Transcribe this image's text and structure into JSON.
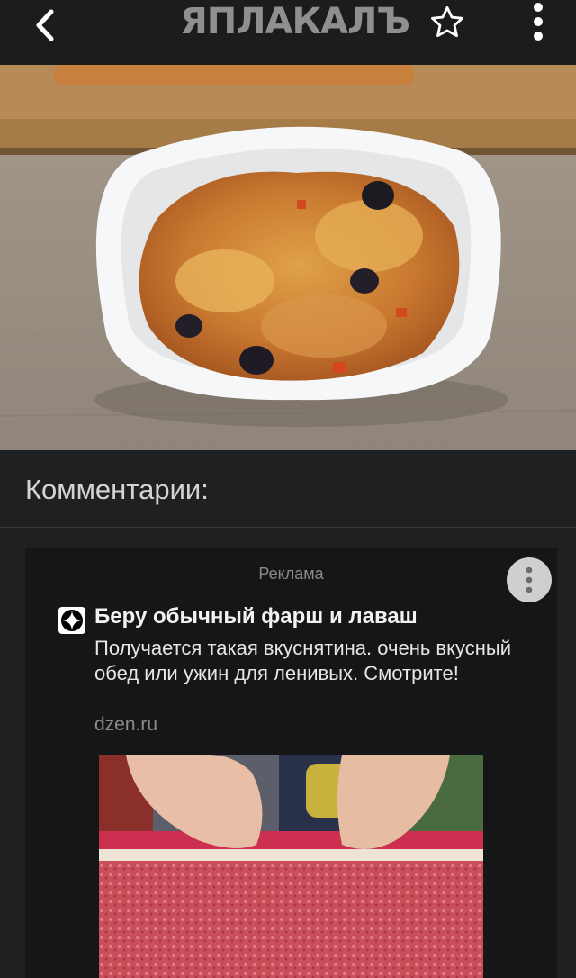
{
  "header": {
    "logo_text": "ЯПЛАКАЛЪ",
    "back_icon": "chevron-left-icon",
    "favorite_icon": "star-outline-icon",
    "menu_icon": "more-vertical-icon"
  },
  "post": {
    "image_description_icon": "food-photo"
  },
  "comments": {
    "heading": "Комментарии:"
  },
  "ad": {
    "label": "Реклама",
    "title": "Беру обычный фарш и лаваш",
    "description": "Получается такая вкуснятина. очень вкусный обед или ужин для ленивых. Смотрите!",
    "domain": "dzen.ru",
    "more_icon": "more-vertical-icon",
    "brand_icon": "dzen-logo-icon"
  },
  "colors": {
    "background": "#1f2022",
    "topbar": "#1c1c1e",
    "ad_card": "#161617",
    "logo": "#8f8f90"
  }
}
